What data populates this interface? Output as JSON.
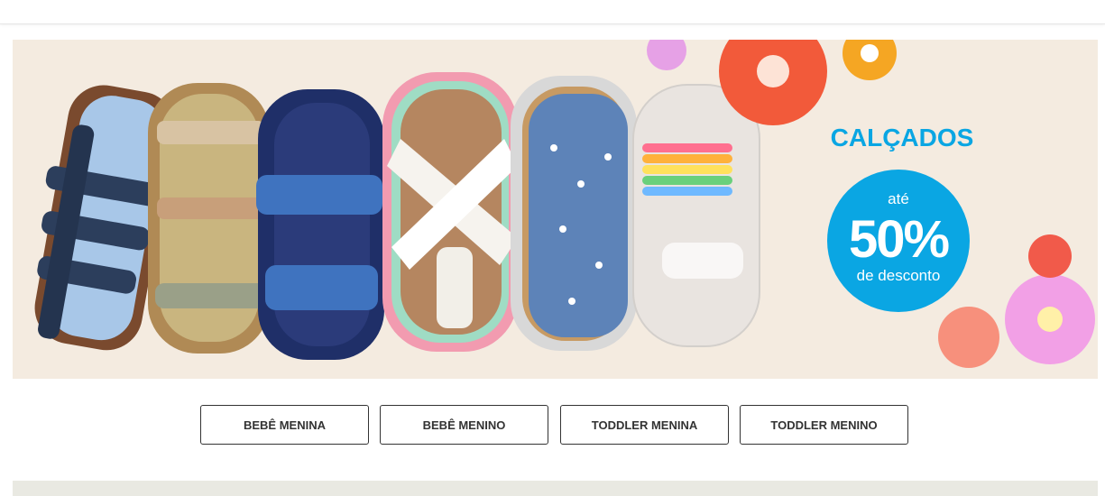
{
  "promo": {
    "title": "CALÇADOS",
    "badge_top": "até",
    "badge_value": "50%",
    "badge_bottom": "de desconto"
  },
  "categories": [
    {
      "label": "BEBÊ MENINA"
    },
    {
      "label": "BEBÊ MENINO"
    },
    {
      "label": "TODDLER MENINA"
    },
    {
      "label": "TODDLER MENINO"
    }
  ],
  "colors": {
    "accent": "#0aa6e3",
    "banner_bg": "#f4ebe0"
  }
}
